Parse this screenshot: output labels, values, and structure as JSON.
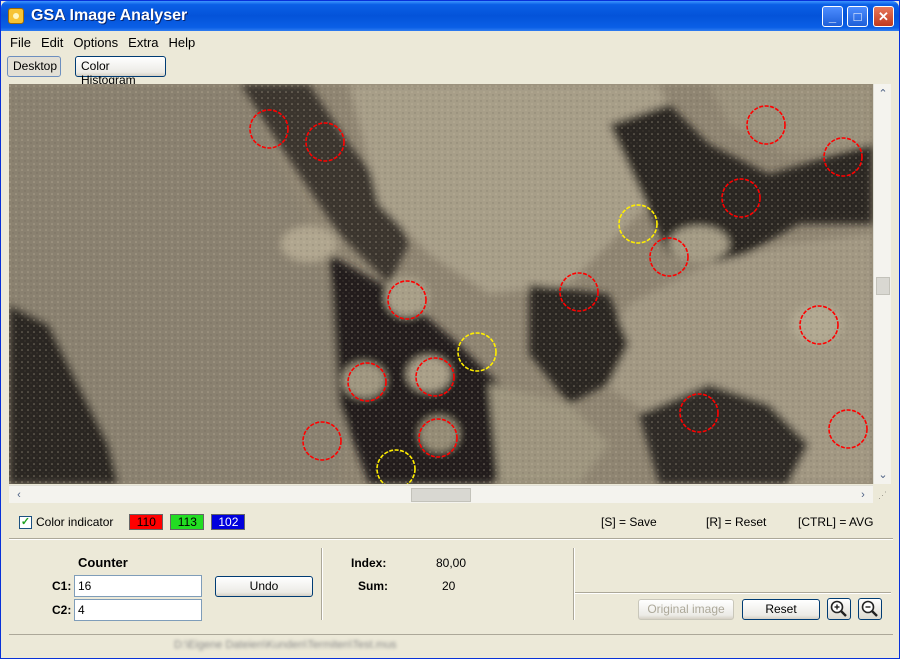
{
  "window": {
    "title": "GSA Image Analyser"
  },
  "menu": [
    {
      "label": "File"
    },
    {
      "label": "Edit"
    },
    {
      "label": "Options"
    },
    {
      "label": "Extra"
    },
    {
      "label": "Help"
    }
  ],
  "toolbar": {
    "desktop": "Desktop",
    "color_histogram": "Color Histogram"
  },
  "color_indicator": {
    "label": "Color indicator",
    "checked": true,
    "r": "110",
    "g": "113",
    "b": "102",
    "r_color": "#ff0000",
    "g_color": "#22dd22",
    "b_color": "#0000dd"
  },
  "shortcuts": {
    "save": "[S] = Save",
    "reset": "[R] = Reset",
    "avg": "[CTRL] = AVG"
  },
  "counter": {
    "title": "Counter",
    "c1_label": "C1:",
    "c1_value": "16",
    "c2_label": "C2:",
    "c2_value": "4",
    "undo": "Undo"
  },
  "stats": {
    "index_label": "Index:",
    "index_value": "80,00",
    "sum_label": "Sum:",
    "sum_value": "20"
  },
  "actions": {
    "original_image": "Original image",
    "reset": "Reset"
  },
  "status": {
    "path": "D:\\Eigene Dateien\\Kunden\\Termiten\\Test.mus"
  },
  "markers": {
    "c1_color": "#ff0000",
    "c2_color": "#ffee00",
    "c1_count": 16,
    "c2_count": 4
  }
}
